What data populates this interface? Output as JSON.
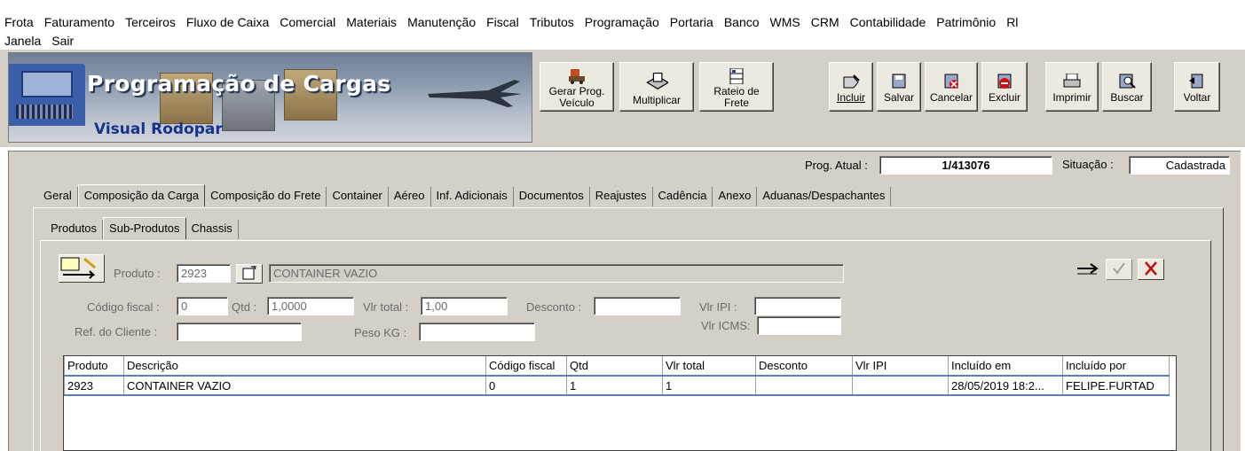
{
  "menu": {
    "row1": [
      "Frota",
      "Faturamento",
      "Terceiros",
      "Fluxo de Caixa",
      "Comercial",
      "Materiais",
      "Manutenção",
      "Fiscal",
      "Tributos",
      "Programação",
      "Portaria",
      "Banco",
      "WMS",
      "CRM",
      "Contabilidade",
      "Patrimônio",
      "Rl"
    ],
    "row2": [
      "Janela",
      "Sair"
    ]
  },
  "banner": {
    "title": "Programação de Cargas",
    "subtitle": "Visual Rodopar"
  },
  "toolbar": {
    "gerar_prog": [
      "Gerar Prog.",
      "Veículo"
    ],
    "multiplicar": "Multiplicar",
    "rateio": [
      "Rateio de",
      "Frete"
    ],
    "incluir": "Incluir",
    "salvar": "Salvar",
    "cancelar": "Cancelar",
    "excluir": "Excluir",
    "imprimir": "Imprimir",
    "buscar": "Buscar",
    "voltar": "Voltar"
  },
  "status": {
    "prog_atual_label": "Prog. Atual :",
    "prog_atual_value": "1/413076",
    "situacao_label": "Situação :",
    "situacao_value": "Cadastrada"
  },
  "tabs": [
    "Geral",
    "Composição da Carga",
    "Composição do Frete",
    "Container",
    "Aéreo",
    "Inf. Adicionais",
    "Documentos",
    "Reajustes",
    "Cadência",
    "Anexo",
    "Aduanas/Despachantes"
  ],
  "subtabs": [
    "Produtos",
    "Sub-Produtos",
    "Chassis"
  ],
  "form": {
    "produto_label": "Produto :",
    "produto_code": "2923",
    "produto_desc": "CONTAINER VAZIO",
    "codigo_fiscal_label": "Código fiscal :",
    "codigo_fiscal_value": "0",
    "qtd_label": "Qtd :",
    "qtd_value": "1,0000",
    "vlr_total_label": "Vlr total :",
    "vlr_total_value": "1,00",
    "desconto_label": "Desconto :",
    "desconto_value": "",
    "vlr_ipi_label": "Vlr IPI :",
    "vlr_ipi_value": "",
    "ref_cliente_label": "Ref. do Cliente :",
    "ref_cliente_value": "",
    "peso_kg_label": "Peso KG :",
    "peso_kg_value": "",
    "vlr_icms_label": "Vlr ICMS:",
    "vlr_icms_value": ""
  },
  "grid": {
    "columns": [
      "Produto",
      "Descrição",
      "Código fiscal",
      "Qtd",
      "Vlr total",
      "Desconto",
      "Vlr IPI",
      "Incluído em",
      "Incluído por"
    ],
    "rows": [
      [
        "2923",
        "CONTAINER VAZIO",
        "0",
        "1",
        "1",
        "",
        "",
        "28/05/2019 18:2...",
        "FELIPE.FURTAD"
      ]
    ]
  }
}
